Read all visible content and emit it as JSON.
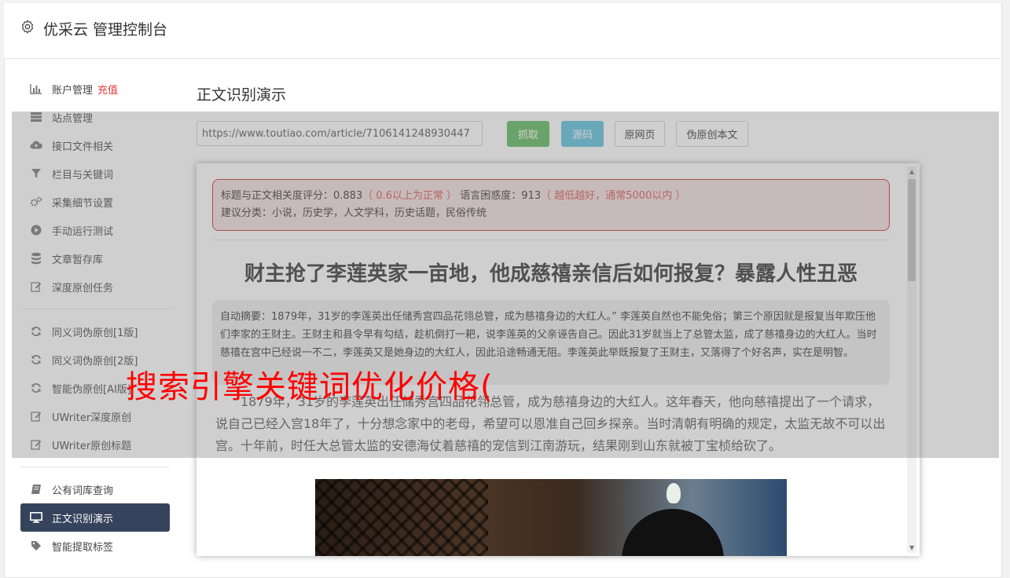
{
  "header": {
    "title": "优采云 管理控制台"
  },
  "sidebar": {
    "group1": [
      {
        "label": "账户管理",
        "badge": "充值",
        "icon": "bar-chart-icon"
      },
      {
        "label": "站点管理",
        "icon": "server-icon"
      },
      {
        "label": "接口文件相关",
        "icon": "cloud-upload-icon"
      },
      {
        "label": "栏目与关键词",
        "icon": "filter-icon"
      },
      {
        "label": "采集细节设置",
        "icon": "gears-icon"
      },
      {
        "label": "手动运行测试",
        "icon": "play-icon"
      },
      {
        "label": "文章暂存库",
        "icon": "database-icon"
      },
      {
        "label": "深度原创任务",
        "icon": "edit-icon"
      }
    ],
    "group2": [
      {
        "label": "同义词伪原创[1版]",
        "icon": "refresh-icon"
      },
      {
        "label": "同义词伪原创[2版]",
        "icon": "refresh-icon"
      },
      {
        "label": "智能伪原创[AI版]",
        "icon": "refresh-icon"
      },
      {
        "label": "UWriter深度原创",
        "icon": "edit-icon"
      },
      {
        "label": "UWriter原创标题",
        "icon": "edit-icon"
      }
    ],
    "group3": [
      {
        "label": "公有词库查询",
        "icon": "book-icon"
      },
      {
        "label": "正文识别演示",
        "icon": "monitor-icon"
      },
      {
        "label": "智能提取标签",
        "icon": "tag-icon"
      }
    ]
  },
  "main": {
    "title": "正文识别演示",
    "url_value": "https://www.toutiao.com/article/7106141248930447",
    "buttons": {
      "fetch": "抓取",
      "source": "源码",
      "original": "原网页",
      "pseudo": "伪原创本文"
    }
  },
  "result": {
    "score_label": "标题与正文相关度评分：0.883",
    "score_note": "（ 0.6以上为正常 ）",
    "perplexity_label": " 语言困惑度：913",
    "perplexity_note": "（ 越低越好，通常5000以内 ）",
    "category": "建议分类：小说，历史学，人文学科，历史话题，民俗传统",
    "article_title": "财主抢了李莲英家一亩地，他成慈禧亲信后如何报复？暴露人性丑恶",
    "summary": "自动摘要：1879年，31岁的李莲英出任储秀宫四品花翎总管，成为慈禧身边的大红人。” 李莲英自然也不能免俗；第三个原因就是报复当年欺压他们李家的王财主。王财主和县令早有勾结，趁机倒打一耙，说李莲英的父亲诬告自己。因此31岁就当上了总管太监，成了慈禧身边的大红人。当时慈禧在宫中已经说一不二，李莲英又是她身边的大红人，因此沿途畅通无阻。李莲英此举既报复了王财主，又落得了个好名声，实在是明智。",
    "body": "1879年，31岁的李莲英出任储秀宫四品花翎总管，成为慈禧身边的大红人。这年春天，他向慈禧提出了一个请求，说自己已经入宫18年了，十分想念家中的老母，希望可以恩准自己回乡探亲。当时清朝有明确的规定，太监无故不可以出宫。十年前，时任大总管太监的安德海仗着慈禧的宠信到江南游玩，结果刚到山东就被丁宝桢给砍了。"
  },
  "overlay_text": "搜索引擎关键词优化价格("
}
